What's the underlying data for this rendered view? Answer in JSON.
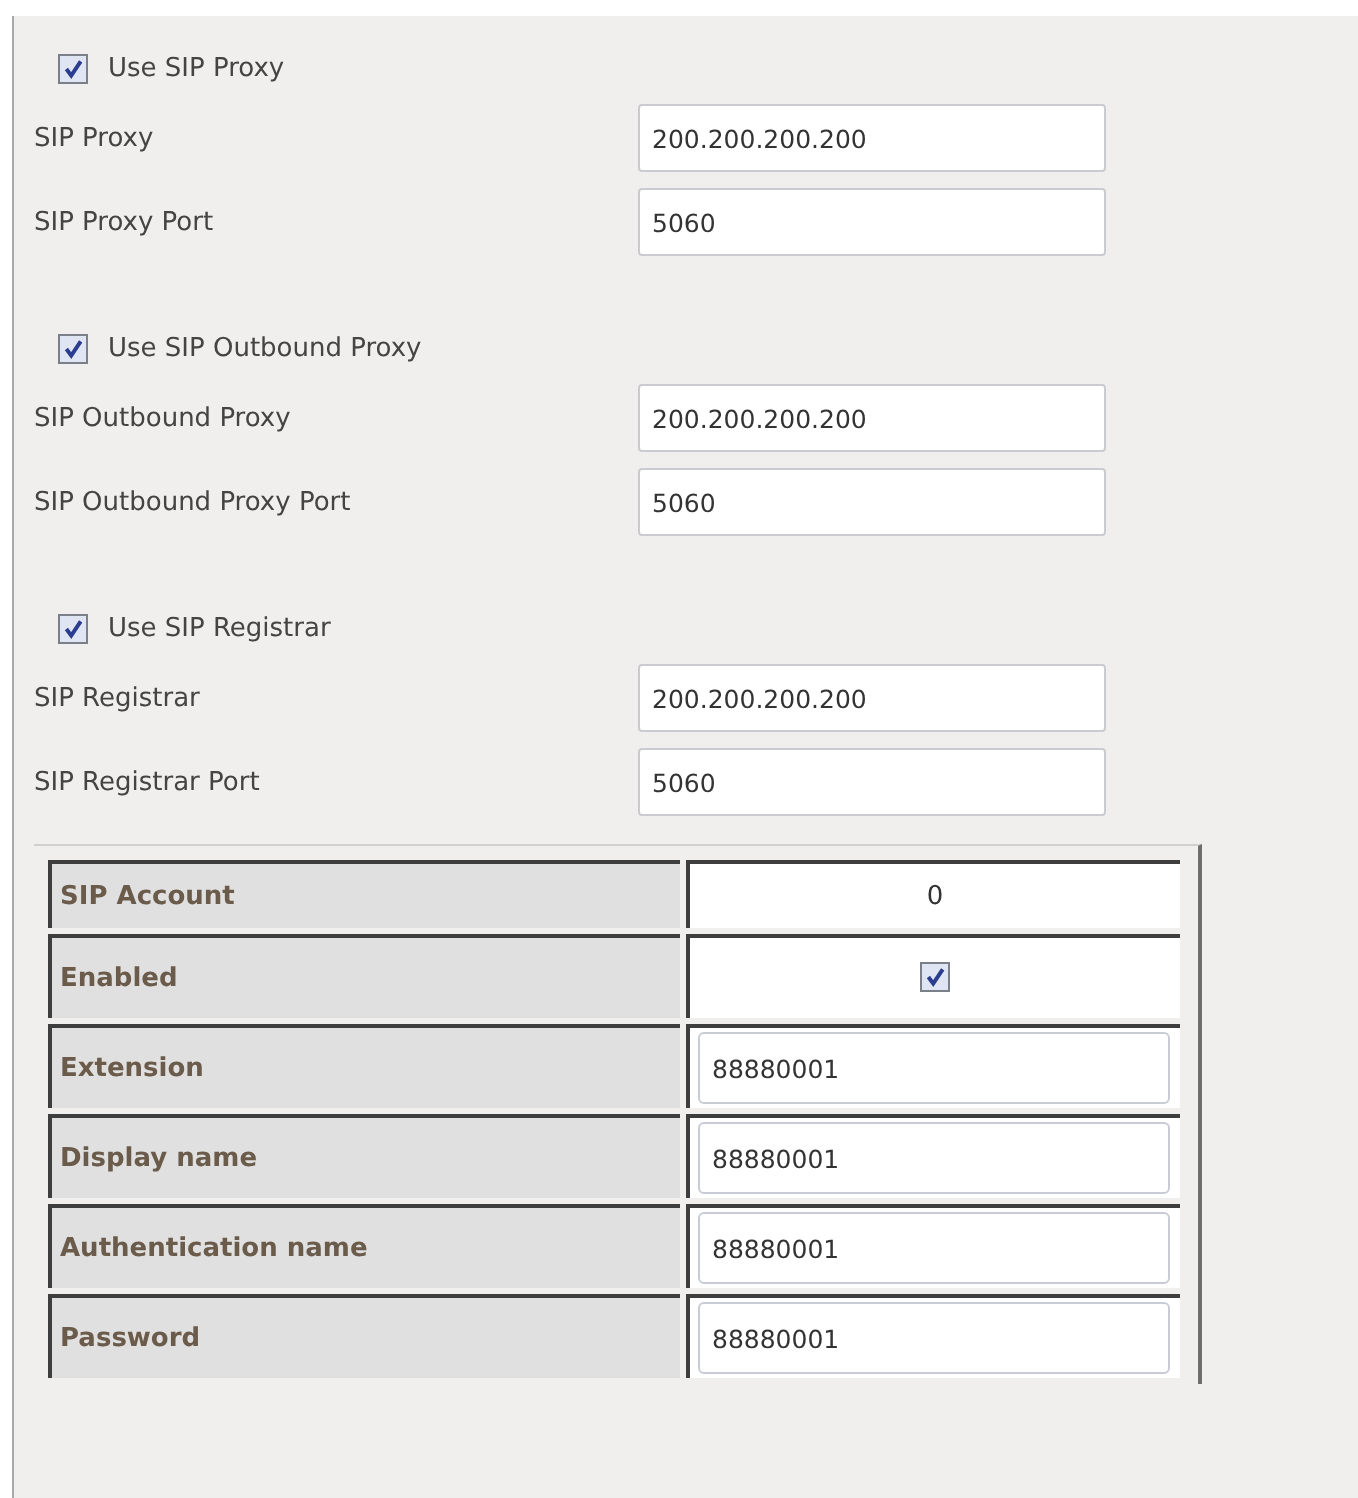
{
  "proxy_sections": [
    {
      "use": {
        "label": "Use SIP Proxy",
        "checked": true
      },
      "fields": [
        {
          "label": "SIP Proxy",
          "value": "200.200.200.200"
        },
        {
          "label": "SIP Proxy Port",
          "value": "5060"
        }
      ]
    },
    {
      "use": {
        "label": "Use SIP Outbound Proxy",
        "checked": true
      },
      "fields": [
        {
          "label": "SIP Outbound Proxy",
          "value": "200.200.200.200"
        },
        {
          "label": "SIP Outbound Proxy Port",
          "value": "5060"
        }
      ]
    },
    {
      "use": {
        "label": "Use SIP Registrar",
        "checked": true
      },
      "fields": [
        {
          "label": "SIP Registrar",
          "value": "200.200.200.200"
        },
        {
          "label": "SIP Registrar Port",
          "value": "5060"
        }
      ]
    }
  ],
  "account_table": {
    "rows": [
      {
        "kind": "text",
        "label": "SIP Account",
        "value": "0"
      },
      {
        "kind": "checkbox",
        "label": "Enabled",
        "checked": true
      },
      {
        "kind": "input",
        "label": "Extension",
        "value": "88880001"
      },
      {
        "kind": "input",
        "label": "Display name",
        "value": "88880001"
      },
      {
        "kind": "input",
        "label": "Authentication name",
        "value": "88880001"
      },
      {
        "kind": "input",
        "label": "Password",
        "value": "88880001"
      }
    ]
  }
}
